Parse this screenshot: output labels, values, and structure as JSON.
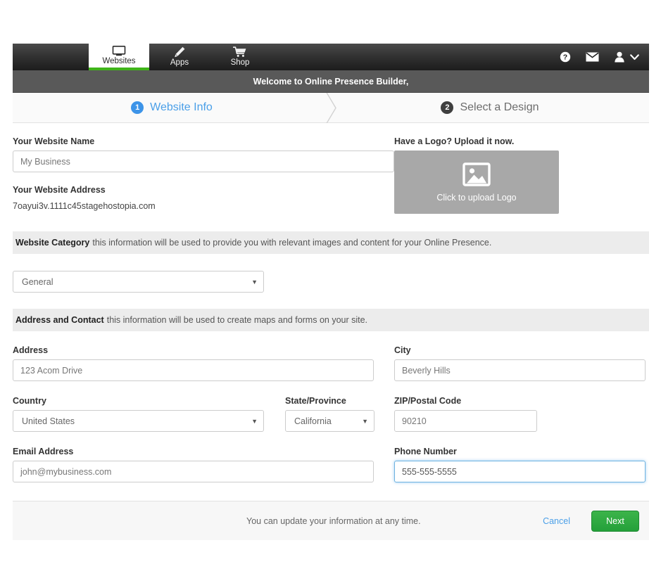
{
  "nav": {
    "tabs": [
      {
        "label": "Websites",
        "icon": "monitor-icon",
        "active": true
      },
      {
        "label": "Apps",
        "icon": "pencil-icon",
        "active": false
      },
      {
        "label": "Shop",
        "icon": "cart-icon",
        "active": false
      }
    ],
    "right_icons": [
      {
        "name": "help-icon"
      },
      {
        "name": "mail-icon"
      },
      {
        "name": "user-icon"
      },
      {
        "name": "chevron-down-icon"
      }
    ],
    "active_tab_underline_color": "#3fb419"
  },
  "welcome": {
    "text": "Welcome to Online Presence Builder,"
  },
  "steps": [
    {
      "number": "1",
      "label": "Website Info",
      "state": "active",
      "color": "#4a9fe8"
    },
    {
      "number": "2",
      "label": "Select a Design",
      "state": "inactive",
      "color": "#6d6d6d"
    }
  ],
  "form": {
    "website_name": {
      "label": "Your Website Name",
      "value": "My Business",
      "placeholder": "My Business"
    },
    "website_address": {
      "label": "Your Website Address",
      "value": "7oayui3v.1111c45stagehostopia.com"
    },
    "logo": {
      "label": "Have a Logo? Upload it now.",
      "button_text": "Click to upload Logo",
      "icon": "image-placeholder-icon",
      "background_color": "#a8a8a8"
    },
    "category_strip": {
      "title": "Website Category",
      "description": "this information will be used to provide you with relevant images and content for your Online Presence."
    },
    "category_select": {
      "value": "General",
      "options": [
        "General"
      ]
    },
    "contact_strip": {
      "title": "Address and Contact",
      "description": "this information will be used to create maps and forms on your site."
    },
    "address": {
      "label": "Address",
      "value": "123 Acom Drive"
    },
    "city": {
      "label": "City",
      "value": "Beverly Hills"
    },
    "country": {
      "label": "Country",
      "value": "United States",
      "options": [
        "United States"
      ]
    },
    "state": {
      "label": "State/Province",
      "value": "California",
      "options": [
        "California"
      ]
    },
    "zip": {
      "label": "ZIP/Postal Code",
      "value": "90210"
    },
    "email": {
      "label": "Email Address",
      "value": "john@mybusiness.com"
    },
    "phone": {
      "label": "Phone Number",
      "value": "555-555-5555",
      "focused": true
    }
  },
  "footer": {
    "note": "You can update your information at any time.",
    "cancel_label": "Cancel",
    "next_label": "Next",
    "next_color": "#2ba93c"
  }
}
